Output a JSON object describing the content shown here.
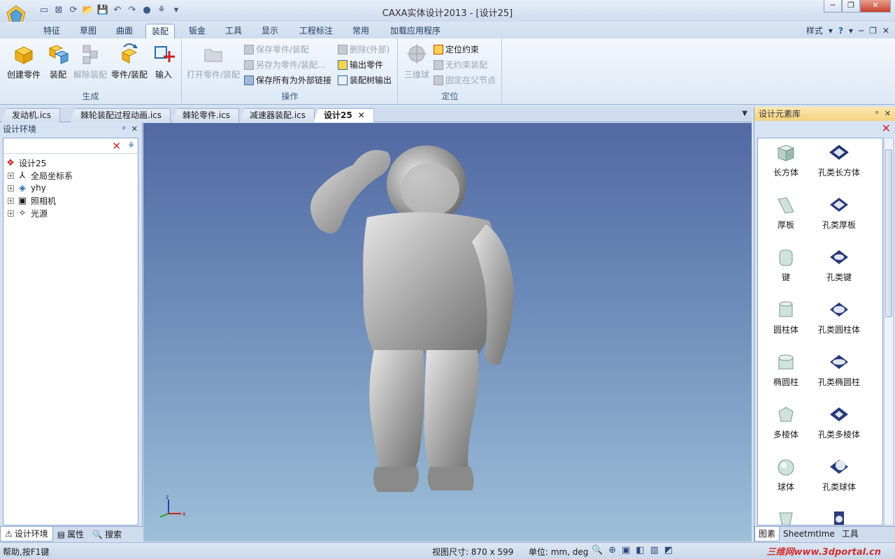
{
  "window": {
    "title": "CAXA实体设计2013 - [设计25]"
  },
  "ribbon_tabs": [
    "特征",
    "草图",
    "曲面",
    "装配",
    "钣金",
    "工具",
    "显示",
    "工程标注",
    "常用",
    "加载应用程序"
  ],
  "active_tab_index": 3,
  "tab_right": {
    "style_label": "样式"
  },
  "groups": {
    "generate": {
      "title": "生成",
      "buttons": [
        "创建零件",
        "装配",
        "解除装配",
        "零件/装配",
        "输入"
      ]
    },
    "operate": {
      "title": "操作",
      "open_button": "打开零件/装配",
      "col1": [
        "保存零件/装配",
        "另存为零件/装配...",
        "保存所有为外部链接"
      ],
      "col2": [
        "删除(外部)",
        "输出零件",
        "装配树输出"
      ]
    },
    "locate": {
      "title": "定位",
      "ball_button": "三维球",
      "items": [
        "定位约束",
        "无约束装配",
        "固定在父节点"
      ]
    }
  },
  "doc_tabs": [
    "发动机.ics",
    "棘轮装配过程动画.ics",
    "棘轮零件.ics",
    "减速器装配.ics",
    "设计25"
  ],
  "active_doc_index": 4,
  "left_panel": {
    "title": "设计环境",
    "tree_root": "设计25",
    "tree_items": [
      "全局坐标系",
      "yhy",
      "照相机",
      "光源"
    ],
    "bottom_tabs": [
      "设计环境",
      "属性",
      "搜索"
    ]
  },
  "viewport": {
    "axis_labels": {
      "z": "z",
      "x": "x"
    }
  },
  "right_panel": {
    "title": "设计元素库",
    "items": [
      "长方体",
      "孔类长方体",
      "厚板",
      "孔类厚板",
      "键",
      "孔类键",
      "圆柱体",
      "孔类圆柱体",
      "椭圆柱",
      "孔类椭圆柱",
      "多棱体",
      "孔类多棱体",
      "球体",
      "孔类球体"
    ],
    "bottom_tabs": [
      "图素",
      "SheetmtIme",
      "工具"
    ]
  },
  "status": {
    "help": "帮助,按F1键",
    "view_size": "视图尺寸: 870 x 599",
    "units": "单位: mm, deg",
    "watermark": "三维网www.3dportal.cn"
  }
}
